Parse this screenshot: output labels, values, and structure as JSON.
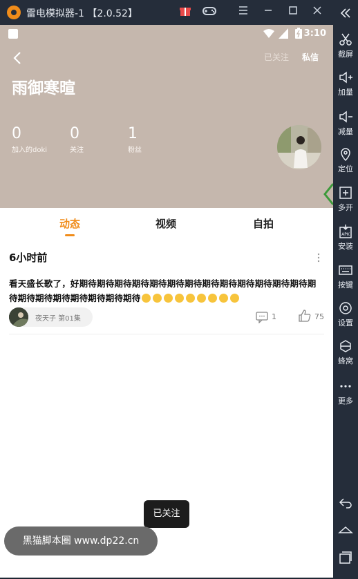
{
  "emulator": {
    "title": "雷电模拟器-1 【2.0.52】",
    "sidebar": [
      {
        "label": "截屏",
        "icon": "scissors-icon"
      },
      {
        "label": "加量",
        "icon": "volume-up-icon"
      },
      {
        "label": "减量",
        "icon": "volume-down-icon"
      },
      {
        "label": "定位",
        "icon": "location-icon"
      },
      {
        "label": "多开",
        "icon": "multi-instance-icon"
      },
      {
        "label": "安装",
        "icon": "apk-install-icon"
      },
      {
        "label": "按键",
        "icon": "keyboard-icon"
      },
      {
        "label": "设置",
        "icon": "gear-icon"
      },
      {
        "label": "蜂窝",
        "icon": "hive-icon"
      },
      {
        "label": "更多",
        "icon": "more-dots-icon"
      }
    ]
  },
  "status_bar": {
    "time": "3:10"
  },
  "profile": {
    "name": "雨御寒暄",
    "followed_label": "已关注",
    "message_label": "私信",
    "stats": [
      {
        "value": "0",
        "label": "加入的doki"
      },
      {
        "value": "0",
        "label": "关注"
      },
      {
        "value": "1",
        "label": "粉丝"
      }
    ]
  },
  "tabs": [
    {
      "label": "动态",
      "active": true
    },
    {
      "label": "视频",
      "active": false
    },
    {
      "label": "自拍",
      "active": false
    }
  ],
  "post": {
    "time": "6小时前",
    "text": "看天盛长歌了，好期待期待期待期待期待期待期待期待期待期待期待期待期待期待期待期待期待期待期待期待期待",
    "emoji_count": 9,
    "doki_name": "夜天子 第01集",
    "comment_count": "1",
    "like_count": "75"
  },
  "toast": {
    "text": "已关注"
  },
  "watermark": {
    "text": "黑猫脚本圈 www.dp22.cn"
  },
  "colors": {
    "accent": "#f08c1a",
    "header_bg": "#c5b7ad",
    "emulator_bg": "#252d3a"
  }
}
